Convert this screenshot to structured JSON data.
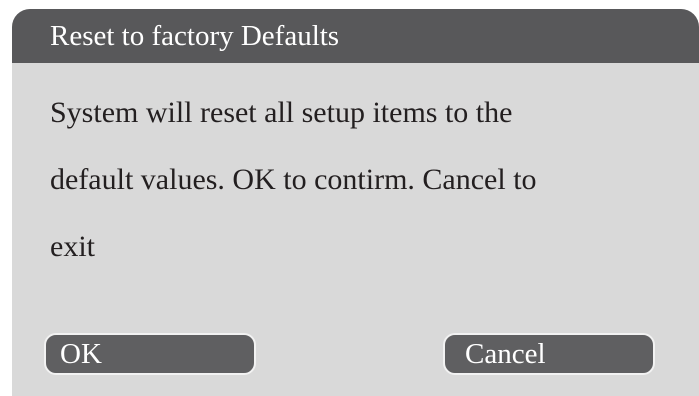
{
  "dialog": {
    "title": "Reset to factory Defaults",
    "message_lines": [
      "System will reset all setup items to the",
      "default values. OK to contirm. Cancel to",
      "exit"
    ],
    "buttons": {
      "ok_label": "OK",
      "cancel_label": "Cancel"
    }
  },
  "colors": {
    "title_bar": "#58585a",
    "dialog_background": "#d9d9d9",
    "button": "#5f5f61",
    "text_dark": "#231f20",
    "text_light": "#ffffff"
  }
}
